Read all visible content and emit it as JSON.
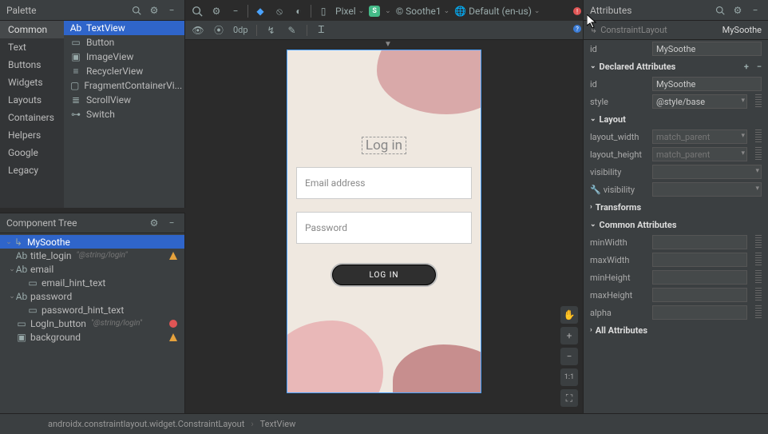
{
  "toolbar": {
    "device": "Pixel",
    "theme": "Soothe1",
    "locale": "Default (en-us)",
    "s_chip": "S",
    "margin": "0dp"
  },
  "palette": {
    "title": "Palette",
    "cats": [
      "Common",
      "Text",
      "Buttons",
      "Widgets",
      "Layouts",
      "Containers",
      "Helpers",
      "Google",
      "Legacy"
    ],
    "items": [
      "TextView",
      "Button",
      "ImageView",
      "RecyclerView",
      "FragmentContainerVi...",
      "ScrollView",
      "Switch"
    ]
  },
  "tree": {
    "title": "Component Tree",
    "root": "MySoothe",
    "n1": "title_login",
    "n1_extra": "\"@string/login\"",
    "n2": "email",
    "n2a": "email_hint_text",
    "n3": "password",
    "n3a": "password_hint_text",
    "n4": "LogIn_button",
    "n4_extra": "\"@string/login\"",
    "n5": "background"
  },
  "attrs": {
    "title": "Attributes",
    "cls": "ConstraintLayout",
    "obj": "MySoothe",
    "id": "MySoothe",
    "sec_decl": "Declared Attributes",
    "d_id": "MySoothe",
    "d_style": "@style/base",
    "sec_layout": "Layout",
    "lw": "match_parent",
    "lh": "match_parent",
    "vis": "visibility",
    "vis2": "visibility",
    "sec_tr": "Transforms",
    "sec_common": "Common Attributes",
    "mw": "minWidth",
    "Mw": "maxWidth",
    "mh": "minHeight",
    "Mh": "maxHeight",
    "al": "alpha",
    "sec_all": "All Attributes",
    "lbl_id": "id",
    "lbl_style": "style",
    "lbl_lw": "layout_width",
    "lbl_lh": "layout_height"
  },
  "preview": {
    "title": "Log in",
    "email": "Email address",
    "pass": "Password",
    "btn": "LOG IN"
  },
  "crumb": {
    "a": "androidx.constraintlayout.widget.ConstraintLayout",
    "b": "TextView"
  },
  "canvas_ctrls": {
    "hand": "✋",
    "plus": "+",
    "minus": "−",
    "fit": "1:1",
    "full": "⛶"
  }
}
